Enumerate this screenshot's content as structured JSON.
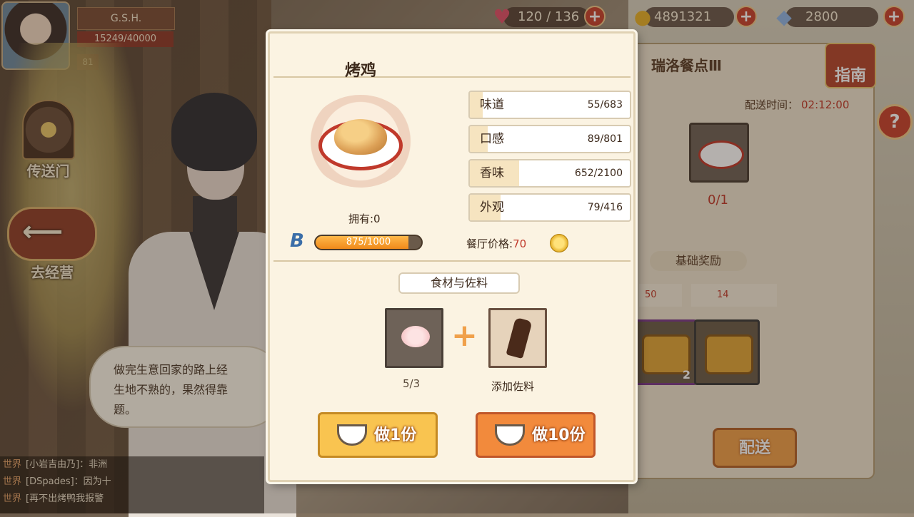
{
  "player": {
    "name": "G.S.H.",
    "exp": "15249/40000",
    "level": "81"
  },
  "resources": [
    {
      "icon": "heart-icon",
      "value": "120 / 136"
    },
    {
      "icon": "gold-coin-icon",
      "value": "4891321"
    },
    {
      "icon": "diamond-icon",
      "value": "2800"
    }
  ],
  "side_buttons": {
    "portal": "传送门",
    "operate": "去经营"
  },
  "chat": [
    {
      "channel": "世界",
      "text": "[小岩吉由乃]：非洲"
    },
    {
      "channel": "世界",
      "text": "[DSpades]：因为十"
    },
    {
      "channel": "世界",
      "text": "[再不出烤鸭我报警"
    }
  ],
  "dialogue": "做完生意回家的路上经\n生地不熟的，果然得靠\n题。",
  "background_panel": {
    "title": "瑞洛餐点Ⅲ",
    "guide": "指南",
    "delivery_label": "配送时间：",
    "delivery_time": "02:12:00",
    "dish_count": "0/1",
    "reward_label": "基础奖励",
    "reward_left": "50",
    "reward_right": "14",
    "chest_count": "2",
    "deliver_button": "配送",
    "help": "?"
  },
  "recipe": {
    "title": "烤鸡",
    "owned": "拥有:0",
    "proficiency_text": "875/1000",
    "proficiency_fraction": 0.875,
    "stats": [
      {
        "name": "味道",
        "value": "55/683",
        "fraction": 0.081
      },
      {
        "name": "口感",
        "value": "89/801",
        "fraction": 0.111
      },
      {
        "name": "香味",
        "value": "652/2100",
        "fraction": 0.31
      },
      {
        "name": "外观",
        "value": "79/416",
        "fraction": 0.19
      }
    ],
    "price_label": "餐厅价格:",
    "price_value": "70",
    "ingredients_title": "食材与佐料",
    "ingredient_count": "5/3",
    "add_seasoning": "添加佐料",
    "cook_one": "做1份",
    "cook_ten": "做10份"
  },
  "colors": {
    "accent_orange": "#f28a3c",
    "accent_yellow": "#f9c450",
    "price_red": "#c0392b",
    "panel_bg": "#fbf3e2"
  }
}
